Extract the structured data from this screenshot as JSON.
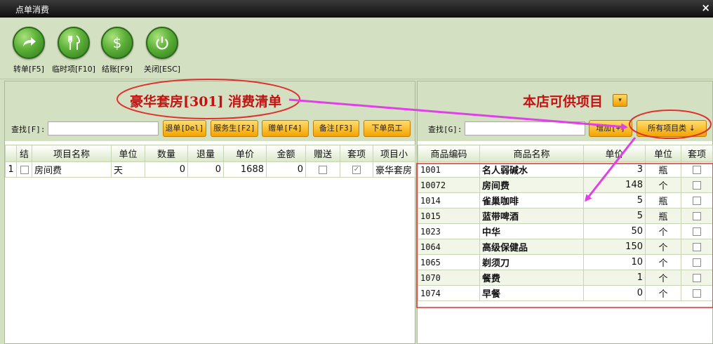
{
  "window": {
    "title": "点单消费",
    "close_glyph": "×"
  },
  "toolbar": {
    "items": [
      {
        "label": "转单[F5]",
        "icon": "transfer-arrow-icon"
      },
      {
        "label": "临时项[F10]",
        "icon": "fork-knife-icon"
      },
      {
        "label": "结账[F9]",
        "icon": "dollar-icon"
      },
      {
        "label": "关闭[ESC]",
        "icon": "power-icon"
      }
    ]
  },
  "bill": {
    "title": "豪华套房[301] 消费清单",
    "search_label": "查找[F]:",
    "search_value": "",
    "buttons": [
      "退单[Del]",
      "服务生[F2]",
      "赠单[F4]",
      "备注[F3]",
      "下单员工"
    ],
    "columns": [
      "",
      "结",
      "项目名称",
      "单位",
      "数量",
      "退量",
      "单价",
      "金额",
      "赠送",
      "套项",
      "项目小"
    ],
    "rows": [
      {
        "index": "1",
        "settled": false,
        "name": "房间费",
        "unit": "天",
        "qty": "0",
        "returned": "0",
        "price": "1688",
        "amount": "0",
        "gift": false,
        "set_item": true,
        "subtotal": "豪华套房"
      }
    ]
  },
  "catalog": {
    "title": "本店可供项目",
    "dropdown_glyph": "▾",
    "search_label": "查找[G]:",
    "search_value": "",
    "add_button": "增加[+]",
    "category_button": "所有项目类 ↓",
    "columns": [
      "商品编码",
      "商品名称",
      "单价",
      "单位",
      "套项"
    ],
    "rows": [
      {
        "code": "1001",
        "name": "名人弱碱水",
        "price": "3",
        "unit": "瓶",
        "set_item": false
      },
      {
        "code": "10072",
        "name": "房间费",
        "price": "148",
        "unit": "个",
        "set_item": false
      },
      {
        "code": "1014",
        "name": "雀巢咖啡",
        "price": "5",
        "unit": "瓶",
        "set_item": false
      },
      {
        "code": "1015",
        "name": "蓝带啤酒",
        "price": "5",
        "unit": "瓶",
        "set_item": false
      },
      {
        "code": "1023",
        "name": "中华",
        "price": "50",
        "unit": "个",
        "set_item": false
      },
      {
        "code": "1064",
        "name": "高级保健品",
        "price": "150",
        "unit": "个",
        "set_item": false
      },
      {
        "code": "1065",
        "name": "剃须刀",
        "price": "10",
        "unit": "个",
        "set_item": false
      },
      {
        "code": "1070",
        "name": "餐费",
        "price": "1",
        "unit": "个",
        "set_item": false
      },
      {
        "code": "1074",
        "name": "早餐",
        "price": "0",
        "unit": "个",
        "set_item": false
      }
    ]
  },
  "colors": {
    "annotation": "#e03030",
    "arrow": "#e040e8",
    "title_red": "#c41212",
    "button_orange": "#f4a400"
  }
}
